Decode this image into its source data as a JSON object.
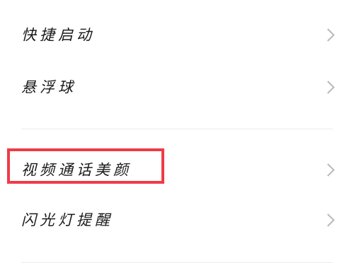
{
  "settings": {
    "items": [
      {
        "label": "快捷启动"
      },
      {
        "label": "悬浮球"
      },
      {
        "label": "视频通话美颜"
      },
      {
        "label": "闪光灯提醒"
      }
    ]
  },
  "colors": {
    "highlight": "#ef3b46",
    "chevron": "#b9b9b9",
    "divider": "#ececec",
    "text": "#1a1a1a"
  },
  "icons": {
    "row_action": "chevron-right-icon"
  }
}
